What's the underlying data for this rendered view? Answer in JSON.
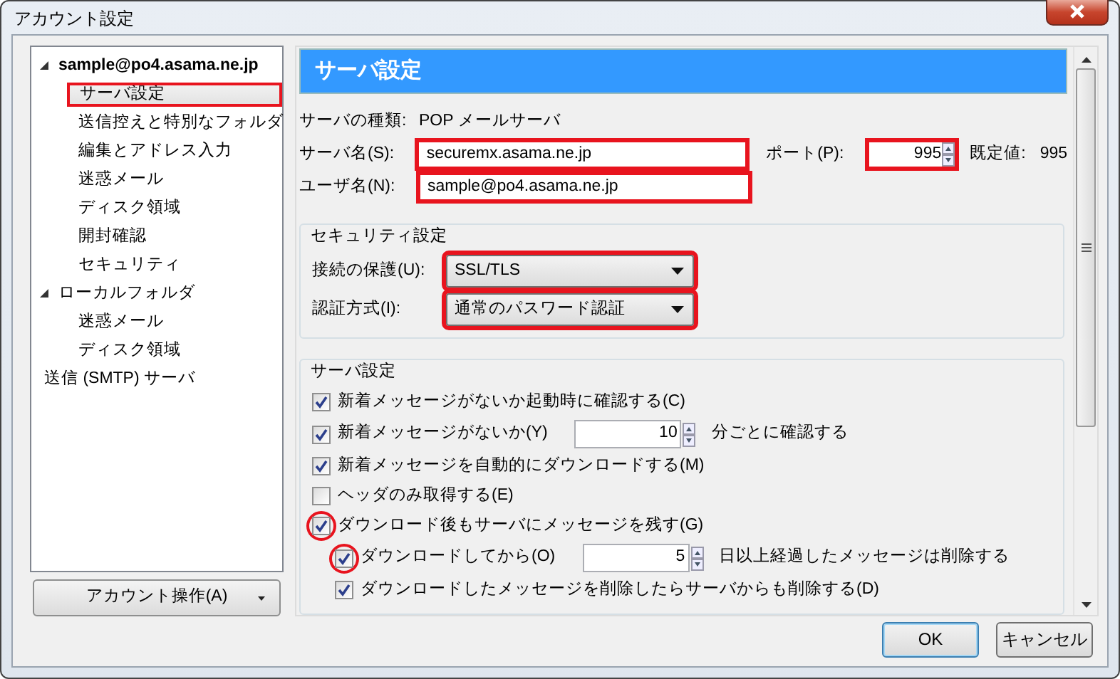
{
  "window": {
    "title": "アカウント設定"
  },
  "tree": [
    {
      "label": "sample@po4.asama.ne.jp",
      "kind": "account",
      "expanded": true,
      "selected": false,
      "highlighted": false,
      "children": [
        {
          "label": "サーバ設定",
          "selected": true,
          "highlighted": true
        },
        {
          "label": "送信控えと特別なフォルダ",
          "selected": false,
          "highlighted": false
        },
        {
          "label": "編集とアドレス入力",
          "selected": false,
          "highlighted": false
        },
        {
          "label": "迷惑メール",
          "selected": false,
          "highlighted": false
        },
        {
          "label": "ディスク領域",
          "selected": false,
          "highlighted": false
        },
        {
          "label": "開封確認",
          "selected": false,
          "highlighted": false
        },
        {
          "label": "セキュリティ",
          "selected": false,
          "highlighted": false
        }
      ]
    },
    {
      "label": "ローカルフォルダ",
      "kind": "folder",
      "expanded": true,
      "selected": false,
      "highlighted": false,
      "children": [
        {
          "label": "迷惑メール",
          "selected": false,
          "highlighted": false
        },
        {
          "label": "ディスク領域",
          "selected": false,
          "highlighted": false
        }
      ]
    },
    {
      "label": "送信 (SMTP) サーバ",
      "kind": "folder",
      "selected": false,
      "highlighted": false
    }
  ],
  "account_actions_button": "アカウント操作(A)",
  "panel": {
    "heading": "サーバ設定",
    "server_type_label": "サーバの種類:",
    "server_type": "POP メールサーバ",
    "fields": [
      {
        "label": "サーバ名(S):",
        "value": "securemx.asama.ne.jp",
        "highlighted": true
      },
      {
        "label": "ユーザ名(N):",
        "value": "sample@po4.asama.ne.jp",
        "highlighted": true
      }
    ],
    "port": {
      "label": "ポート(P):",
      "value": "995",
      "highlighted": true
    },
    "default_label": "既定値:",
    "default_value": "995",
    "security": {
      "title": "セキュリティ設定",
      "selects": [
        {
          "label": "接続の保護(U):",
          "value": "SSL/TLS",
          "highlighted": true
        },
        {
          "label": "認証方式(I):",
          "value": "通常のパスワード認証",
          "highlighted": true
        }
      ]
    },
    "server_settings": {
      "title": "サーバ設定",
      "options": [
        {
          "label": "新着メッセージがないか起動時に確認する(C)",
          "checked": true,
          "circled": false
        },
        {
          "label": "新着メッセージがないか(Y)",
          "checked": true,
          "circled": false,
          "spin": "10",
          "suffix": "分ごとに確認する"
        },
        {
          "label": "新着メッセージを自動的にダウンロードする(M)",
          "checked": true,
          "circled": false
        },
        {
          "label": "ヘッダのみ取得する(E)",
          "checked": false,
          "circled": false
        },
        {
          "label": "ダウンロード後もサーバにメッセージを残す(G)",
          "checked": true,
          "circled": true,
          "children": [
            {
              "label": "ダウンロードしてから(O)",
              "checked": true,
              "circled": true,
              "spin": "5",
              "suffix": "日以上経過したメッセージは削除する"
            },
            {
              "label": "ダウンロードしたメッセージを削除したらサーバからも削除する(D)",
              "checked": true,
              "circled": false
            }
          ]
        }
      ]
    }
  },
  "buttons": [
    {
      "label": "OK",
      "default": true
    },
    {
      "label": "キャンセル",
      "default": false
    }
  ]
}
